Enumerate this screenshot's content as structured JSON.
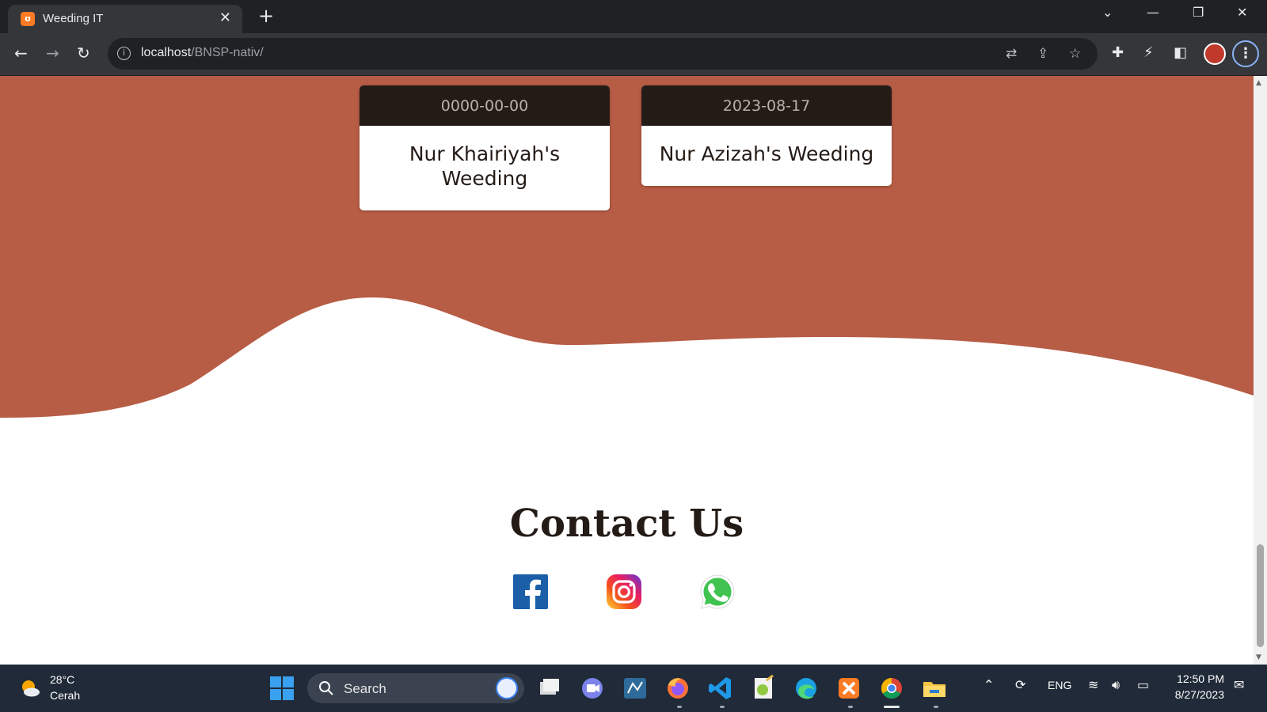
{
  "browser": {
    "tab_title": "Weeding IT",
    "tab_favicon_text": "ʊ",
    "url_host": "localhost",
    "url_path": "/BNSP-nativ/"
  },
  "events": [
    {
      "date": "0000-00-00",
      "title": "Nur Khairiyah's Weeding"
    },
    {
      "date": "2023-08-17",
      "title": "Nur Azizah's Weeding"
    }
  ],
  "contact": {
    "title": "Contact Us",
    "socials": [
      "facebook-icon",
      "instagram-icon",
      "whatsapp-icon"
    ]
  },
  "colors": {
    "hero_bg": "#b75c45",
    "card_header": "#241b16",
    "text_dark": "#241b16"
  },
  "taskbar": {
    "weather_temp": "28°C",
    "weather_desc": "Cerah",
    "search_label": "Search",
    "language": "ENG",
    "time": "12:50 PM",
    "date": "8/27/2023"
  }
}
